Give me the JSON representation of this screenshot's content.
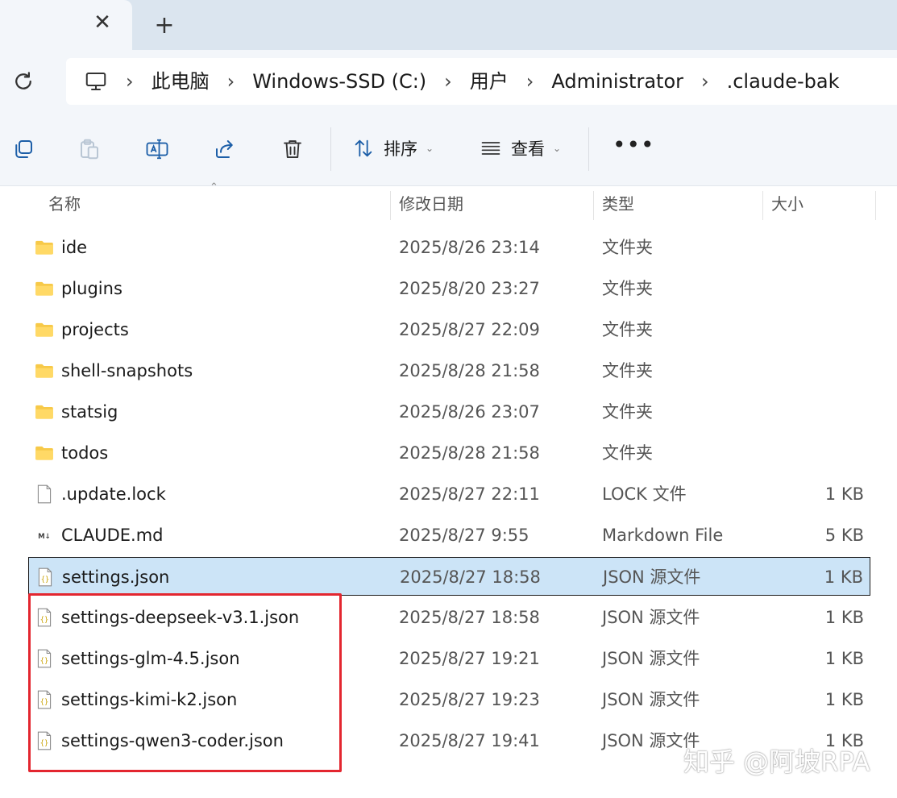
{
  "tabs": {
    "close_glyph": "✕",
    "new_glyph": "+"
  },
  "breadcrumb": {
    "items": [
      "此电脑",
      "Windows-SSD (C:)",
      "用户",
      "Administrator",
      ".claude-bak"
    ],
    "separator": "›"
  },
  "toolbar": {
    "sort_label": "排序",
    "view_label": "查看",
    "more_label": "•••",
    "icons": [
      "copy-icon",
      "paste-icon",
      "rename-icon",
      "share-icon",
      "delete-icon",
      "sort-icon",
      "view-icon",
      "more-icon"
    ]
  },
  "columns": {
    "name": "名称",
    "date": "修改日期",
    "type": "类型",
    "size": "大小"
  },
  "files": [
    {
      "name": "ide",
      "date": "2025/8/26 23:14",
      "type": "文件夹",
      "size": "",
      "icon": "folder"
    },
    {
      "name": "plugins",
      "date": "2025/8/20 23:27",
      "type": "文件夹",
      "size": "",
      "icon": "folder"
    },
    {
      "name": "projects",
      "date": "2025/8/27 22:09",
      "type": "文件夹",
      "size": "",
      "icon": "folder"
    },
    {
      "name": "shell-snapshots",
      "date": "2025/8/28 21:58",
      "type": "文件夹",
      "size": "",
      "icon": "folder"
    },
    {
      "name": "statsig",
      "date": "2025/8/26 23:07",
      "type": "文件夹",
      "size": "",
      "icon": "folder"
    },
    {
      "name": "todos",
      "date": "2025/8/28 21:58",
      "type": "文件夹",
      "size": "",
      "icon": "folder"
    },
    {
      "name": ".update.lock",
      "date": "2025/8/27 22:11",
      "type": "LOCK 文件",
      "size": "1 KB",
      "icon": "file"
    },
    {
      "name": "CLAUDE.md",
      "date": "2025/8/27 9:55",
      "type": "Markdown File",
      "size": "5 KB",
      "icon": "markdown"
    },
    {
      "name": "settings.json",
      "date": "2025/8/27 18:58",
      "type": "JSON 源文件",
      "size": "1 KB",
      "icon": "json",
      "selected": true
    },
    {
      "name": "settings-deepseek-v3.1.json",
      "date": "2025/8/27 18:58",
      "type": "JSON 源文件",
      "size": "1 KB",
      "icon": "json"
    },
    {
      "name": "settings-glm-4.5.json",
      "date": "2025/8/27 19:21",
      "type": "JSON 源文件",
      "size": "1 KB",
      "icon": "json"
    },
    {
      "name": "settings-kimi-k2.json",
      "date": "2025/8/27 19:23",
      "type": "JSON 源文件",
      "size": "1 KB",
      "icon": "json"
    },
    {
      "name": "settings-qwen3-coder.json",
      "date": "2025/8/27 19:41",
      "type": "JSON 源文件",
      "size": "1 KB",
      "icon": "json"
    }
  ],
  "watermark": "知乎 @阿坡RPA",
  "colors": {
    "selection": "#cce4f7",
    "highlight_box": "#e3262f",
    "folder": "#f7c948"
  }
}
